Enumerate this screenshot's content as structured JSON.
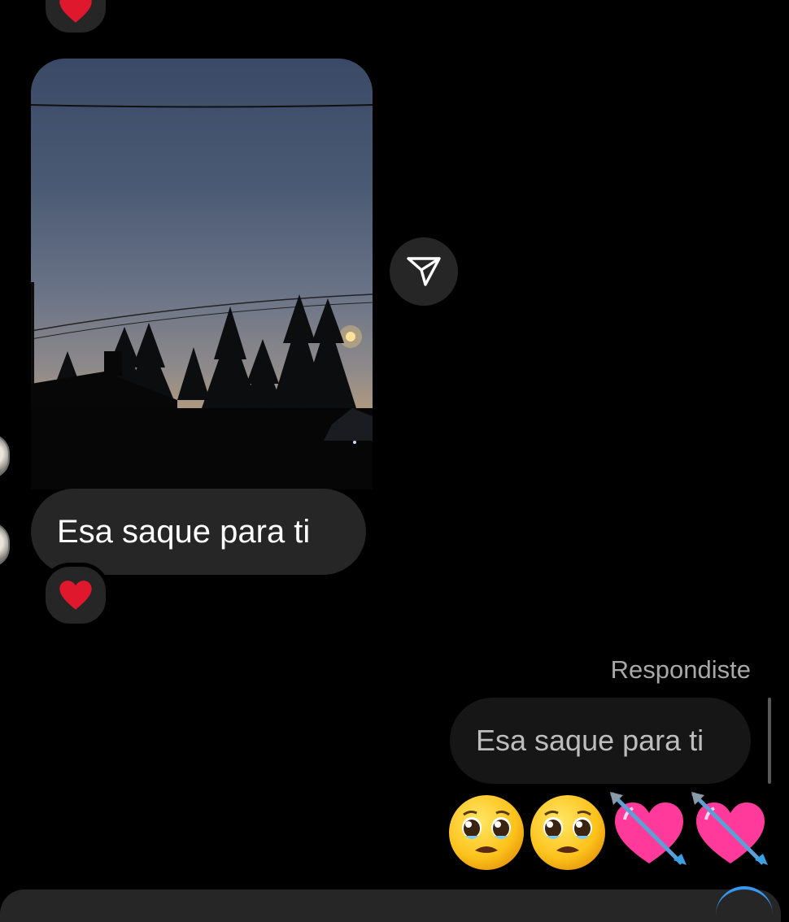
{
  "messages": {
    "incoming_text": "Esa saque para ti",
    "replied_label": "Respondiste",
    "quoted_text": "Esa saque para ti",
    "reply_emojis": [
      "pleading-face",
      "pleading-face",
      "heart-with-arrow",
      "heart-with-arrow"
    ]
  },
  "reactions": {
    "top": "heart",
    "incoming_text": "heart"
  },
  "icons": {
    "share": "paper-plane-icon"
  },
  "colors": {
    "background": "#000000",
    "bubble_incoming": "#262626",
    "bubble_quote": "#161616",
    "replied_label": "#a8a8a8",
    "heart": "#e0182d",
    "accent": "#3797f0"
  }
}
